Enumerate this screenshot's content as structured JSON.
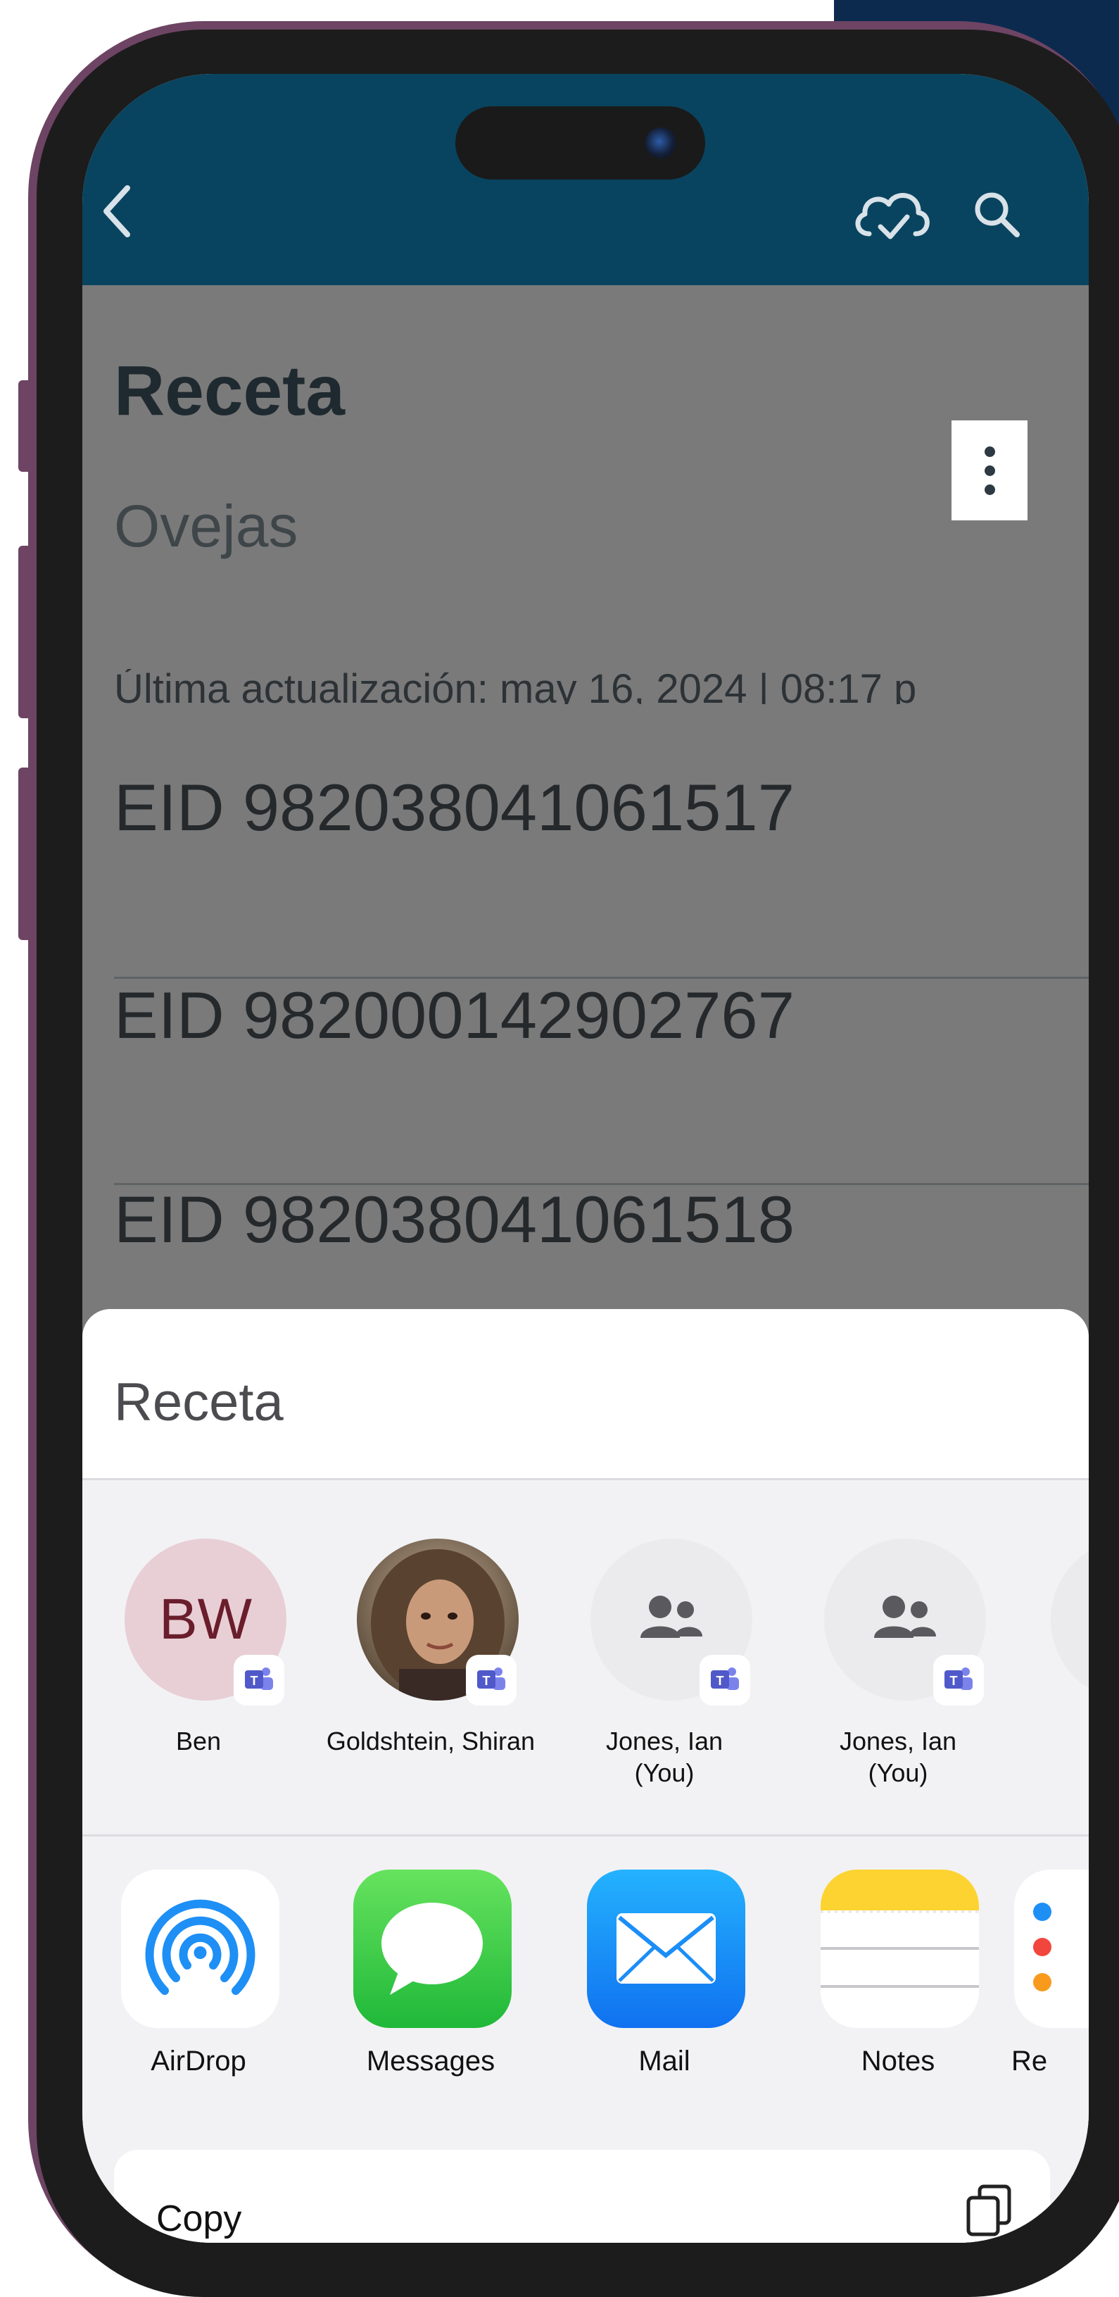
{
  "header": {
    "back_icon": "chevron-left-icon",
    "sync_icon": "cloud-check-icon",
    "search_icon": "search-icon",
    "background": "#08445f"
  },
  "page": {
    "title": "Receta",
    "subtitle": "Ovejas",
    "last_updated": "Última actualización: may 16, 2024 | 08:17 p",
    "more_icon": "more-vertical-icon"
  },
  "eid_list": [
    "EID 982038041061517",
    "EID 982000142902767",
    "EID 982038041061518"
  ],
  "share_sheet": {
    "title": "Receta",
    "people": [
      {
        "initials": "BW",
        "name": "Ben",
        "badge": "teams-icon"
      },
      {
        "initials": "",
        "name": "Goldshtein, Shiran",
        "badge": "teams-icon"
      },
      {
        "initials": "",
        "name": "Jones, Ian (You)",
        "badge": "teams-icon"
      },
      {
        "initials": "",
        "name": "Jones, Ian (You)",
        "badge": "teams-icon"
      }
    ],
    "apps": [
      {
        "label": "AirDrop",
        "icon": "airdrop-icon"
      },
      {
        "label": "Messages",
        "icon": "messages-icon"
      },
      {
        "label": "Mail",
        "icon": "mail-icon"
      },
      {
        "label": "Notes",
        "icon": "notes-icon"
      },
      {
        "label": "Re",
        "icon": "reminders-icon"
      }
    ],
    "copy_action": {
      "label": "Copy",
      "icon": "copy-icon"
    }
  }
}
